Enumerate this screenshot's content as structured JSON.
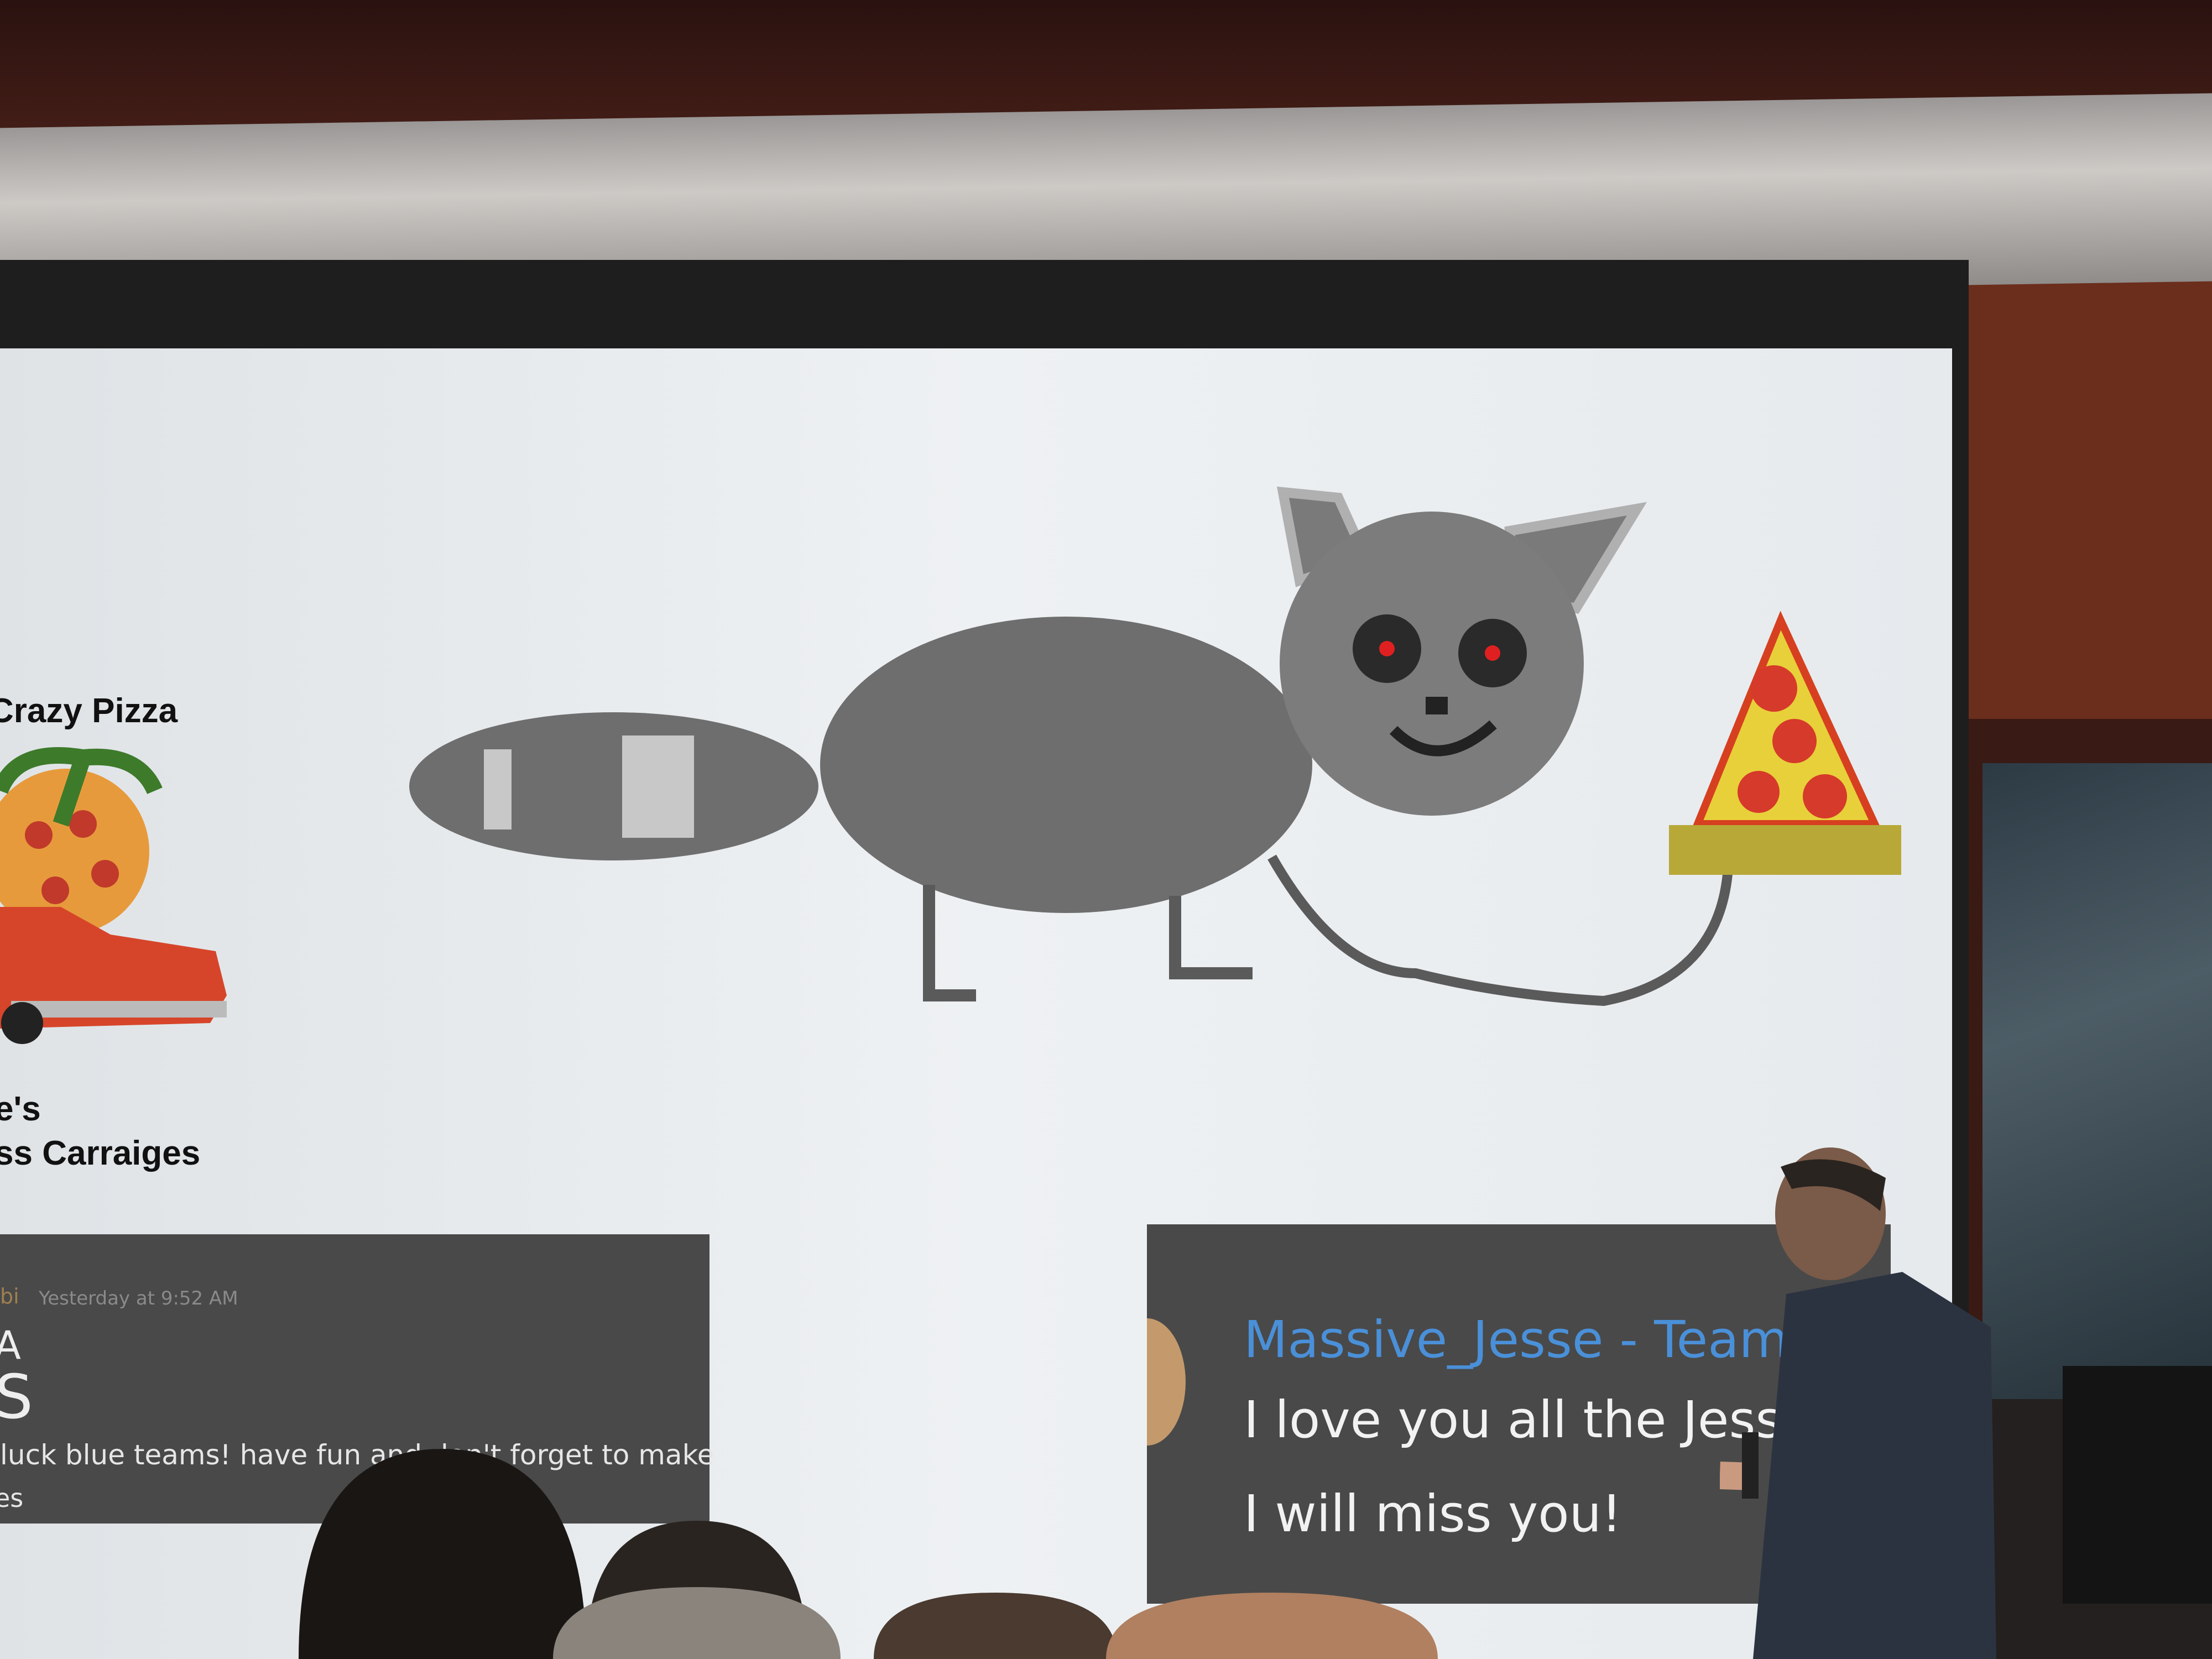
{
  "slide": {
    "left_panel": {
      "title_fragment": "Crazy Pizza",
      "subtitle_line1": "e's",
      "subtitle_line2": "ss Carraiges"
    },
    "left_message": {
      "author_fragment": "bi",
      "timestamp": "Yesterday at 9:52 AM",
      "large_fragment_1": "A",
      "large_fragment_2": "S",
      "text_line1": "luck blue teams! have fun and don't forget to make",
      "text_line2": "es"
    },
    "right_message": {
      "author": "Massive_Jesse - Team",
      "line1": "I love you all the Jesse",
      "line2": "I will miss you!"
    }
  },
  "colors": {
    "author_blue": "#4a90d9",
    "card_bg": "#494949",
    "eye_red": "#e02020",
    "pizza_yellow": "#e8d03a"
  }
}
